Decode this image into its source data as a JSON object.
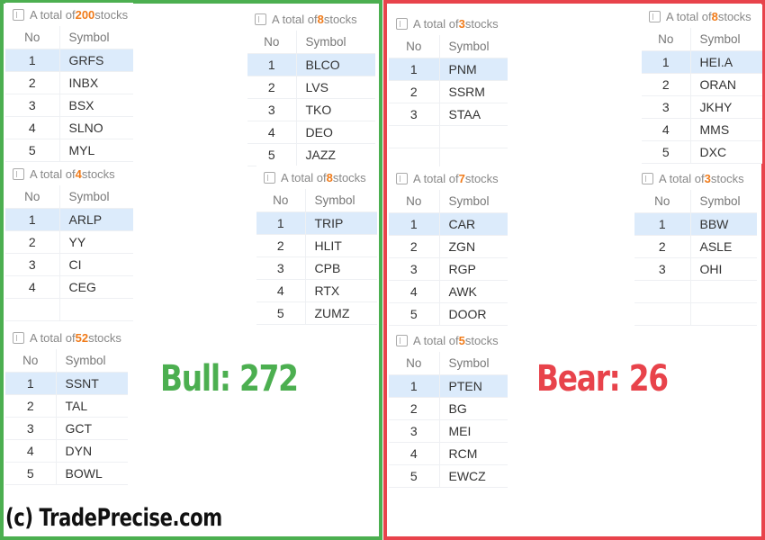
{
  "bull": {
    "label": "Bull: 272",
    "color": "#4caf50",
    "panels": [
      {
        "prefix": "A total of ",
        "count": "200",
        "suffix": " stocks",
        "headers": {
          "no": "No",
          "symbol": "Symbol"
        },
        "rows": [
          {
            "no": "1",
            "symbol": "GRFS"
          },
          {
            "no": "2",
            "symbol": "INBX"
          },
          {
            "no": "3",
            "symbol": "BSX"
          },
          {
            "no": "4",
            "symbol": "SLNO"
          },
          {
            "no": "5",
            "symbol": "MYL"
          }
        ]
      },
      {
        "prefix": "A total of ",
        "count": "8",
        "suffix": " stocks",
        "headers": {
          "no": "No",
          "symbol": "Symbol"
        },
        "rows": [
          {
            "no": "1",
            "symbol": "BLCO"
          },
          {
            "no": "2",
            "symbol": "LVS"
          },
          {
            "no": "3",
            "symbol": "TKO"
          },
          {
            "no": "4",
            "symbol": "DEO"
          },
          {
            "no": "5",
            "symbol": "JAZZ"
          }
        ]
      },
      {
        "prefix": "A total of ",
        "count": "4",
        "suffix": " stocks",
        "headers": {
          "no": "No",
          "symbol": "Symbol"
        },
        "rows": [
          {
            "no": "1",
            "symbol": "ARLP"
          },
          {
            "no": "2",
            "symbol": "YY"
          },
          {
            "no": "3",
            "symbol": "CI"
          },
          {
            "no": "4",
            "symbol": "CEG"
          }
        ]
      },
      {
        "prefix": "A total of ",
        "count": "8",
        "suffix": " stocks",
        "headers": {
          "no": "No",
          "symbol": "Symbol"
        },
        "rows": [
          {
            "no": "1",
            "symbol": "TRIP"
          },
          {
            "no": "2",
            "symbol": "HLIT"
          },
          {
            "no": "3",
            "symbol": "CPB"
          },
          {
            "no": "4",
            "symbol": "RTX"
          },
          {
            "no": "5",
            "symbol": "ZUMZ"
          }
        ]
      },
      {
        "prefix": "A total of ",
        "count": "52",
        "suffix": " stocks",
        "headers": {
          "no": "No",
          "symbol": "Symbol"
        },
        "rows": [
          {
            "no": "1",
            "symbol": "SSNT"
          },
          {
            "no": "2",
            "symbol": "TAL"
          },
          {
            "no": "3",
            "symbol": "GCT"
          },
          {
            "no": "4",
            "symbol": "DYN"
          },
          {
            "no": "5",
            "symbol": "BOWL"
          }
        ]
      }
    ]
  },
  "bear": {
    "label": "Bear: 26",
    "color": "#e8434b",
    "panels": [
      {
        "prefix": "A total of ",
        "count": "3",
        "suffix": " stocks",
        "headers": {
          "no": "No",
          "symbol": "Symbol"
        },
        "rows": [
          {
            "no": "1",
            "symbol": "PNM"
          },
          {
            "no": "2",
            "symbol": "SSRM"
          },
          {
            "no": "3",
            "symbol": "STAA"
          }
        ]
      },
      {
        "prefix": "A total of ",
        "count": "8",
        "suffix": " stocks",
        "headers": {
          "no": "No",
          "symbol": "Symbol"
        },
        "rows": [
          {
            "no": "1",
            "symbol": "HEI.A"
          },
          {
            "no": "2",
            "symbol": "ORAN"
          },
          {
            "no": "3",
            "symbol": "JKHY"
          },
          {
            "no": "4",
            "symbol": "MMS"
          },
          {
            "no": "5",
            "symbol": "DXC"
          }
        ]
      },
      {
        "prefix": "A total of ",
        "count": "7",
        "suffix": " stocks",
        "headers": {
          "no": "No",
          "symbol": "Symbol"
        },
        "rows": [
          {
            "no": "1",
            "symbol": "CAR"
          },
          {
            "no": "2",
            "symbol": "ZGN"
          },
          {
            "no": "3",
            "symbol": "RGP"
          },
          {
            "no": "4",
            "symbol": "AWK"
          },
          {
            "no": "5",
            "symbol": "DOOR"
          }
        ]
      },
      {
        "prefix": "A total of ",
        "count": "3",
        "suffix": " stocks",
        "headers": {
          "no": "No",
          "symbol": "Symbol"
        },
        "rows": [
          {
            "no": "1",
            "symbol": "BBW"
          },
          {
            "no": "2",
            "symbol": "ASLE"
          },
          {
            "no": "3",
            "symbol": "OHI"
          }
        ]
      },
      {
        "prefix": "A total of ",
        "count": "5",
        "suffix": " stocks",
        "headers": {
          "no": "No",
          "symbol": "Symbol"
        },
        "rows": [
          {
            "no": "1",
            "symbol": "PTEN"
          },
          {
            "no": "2",
            "symbol": "BG"
          },
          {
            "no": "3",
            "symbol": "MEI"
          },
          {
            "no": "4",
            "symbol": "RCM"
          },
          {
            "no": "5",
            "symbol": "EWCZ"
          }
        ]
      }
    ]
  },
  "watermark": "(c) TradePrecise.com",
  "accent_count_color": "#f07b1a"
}
